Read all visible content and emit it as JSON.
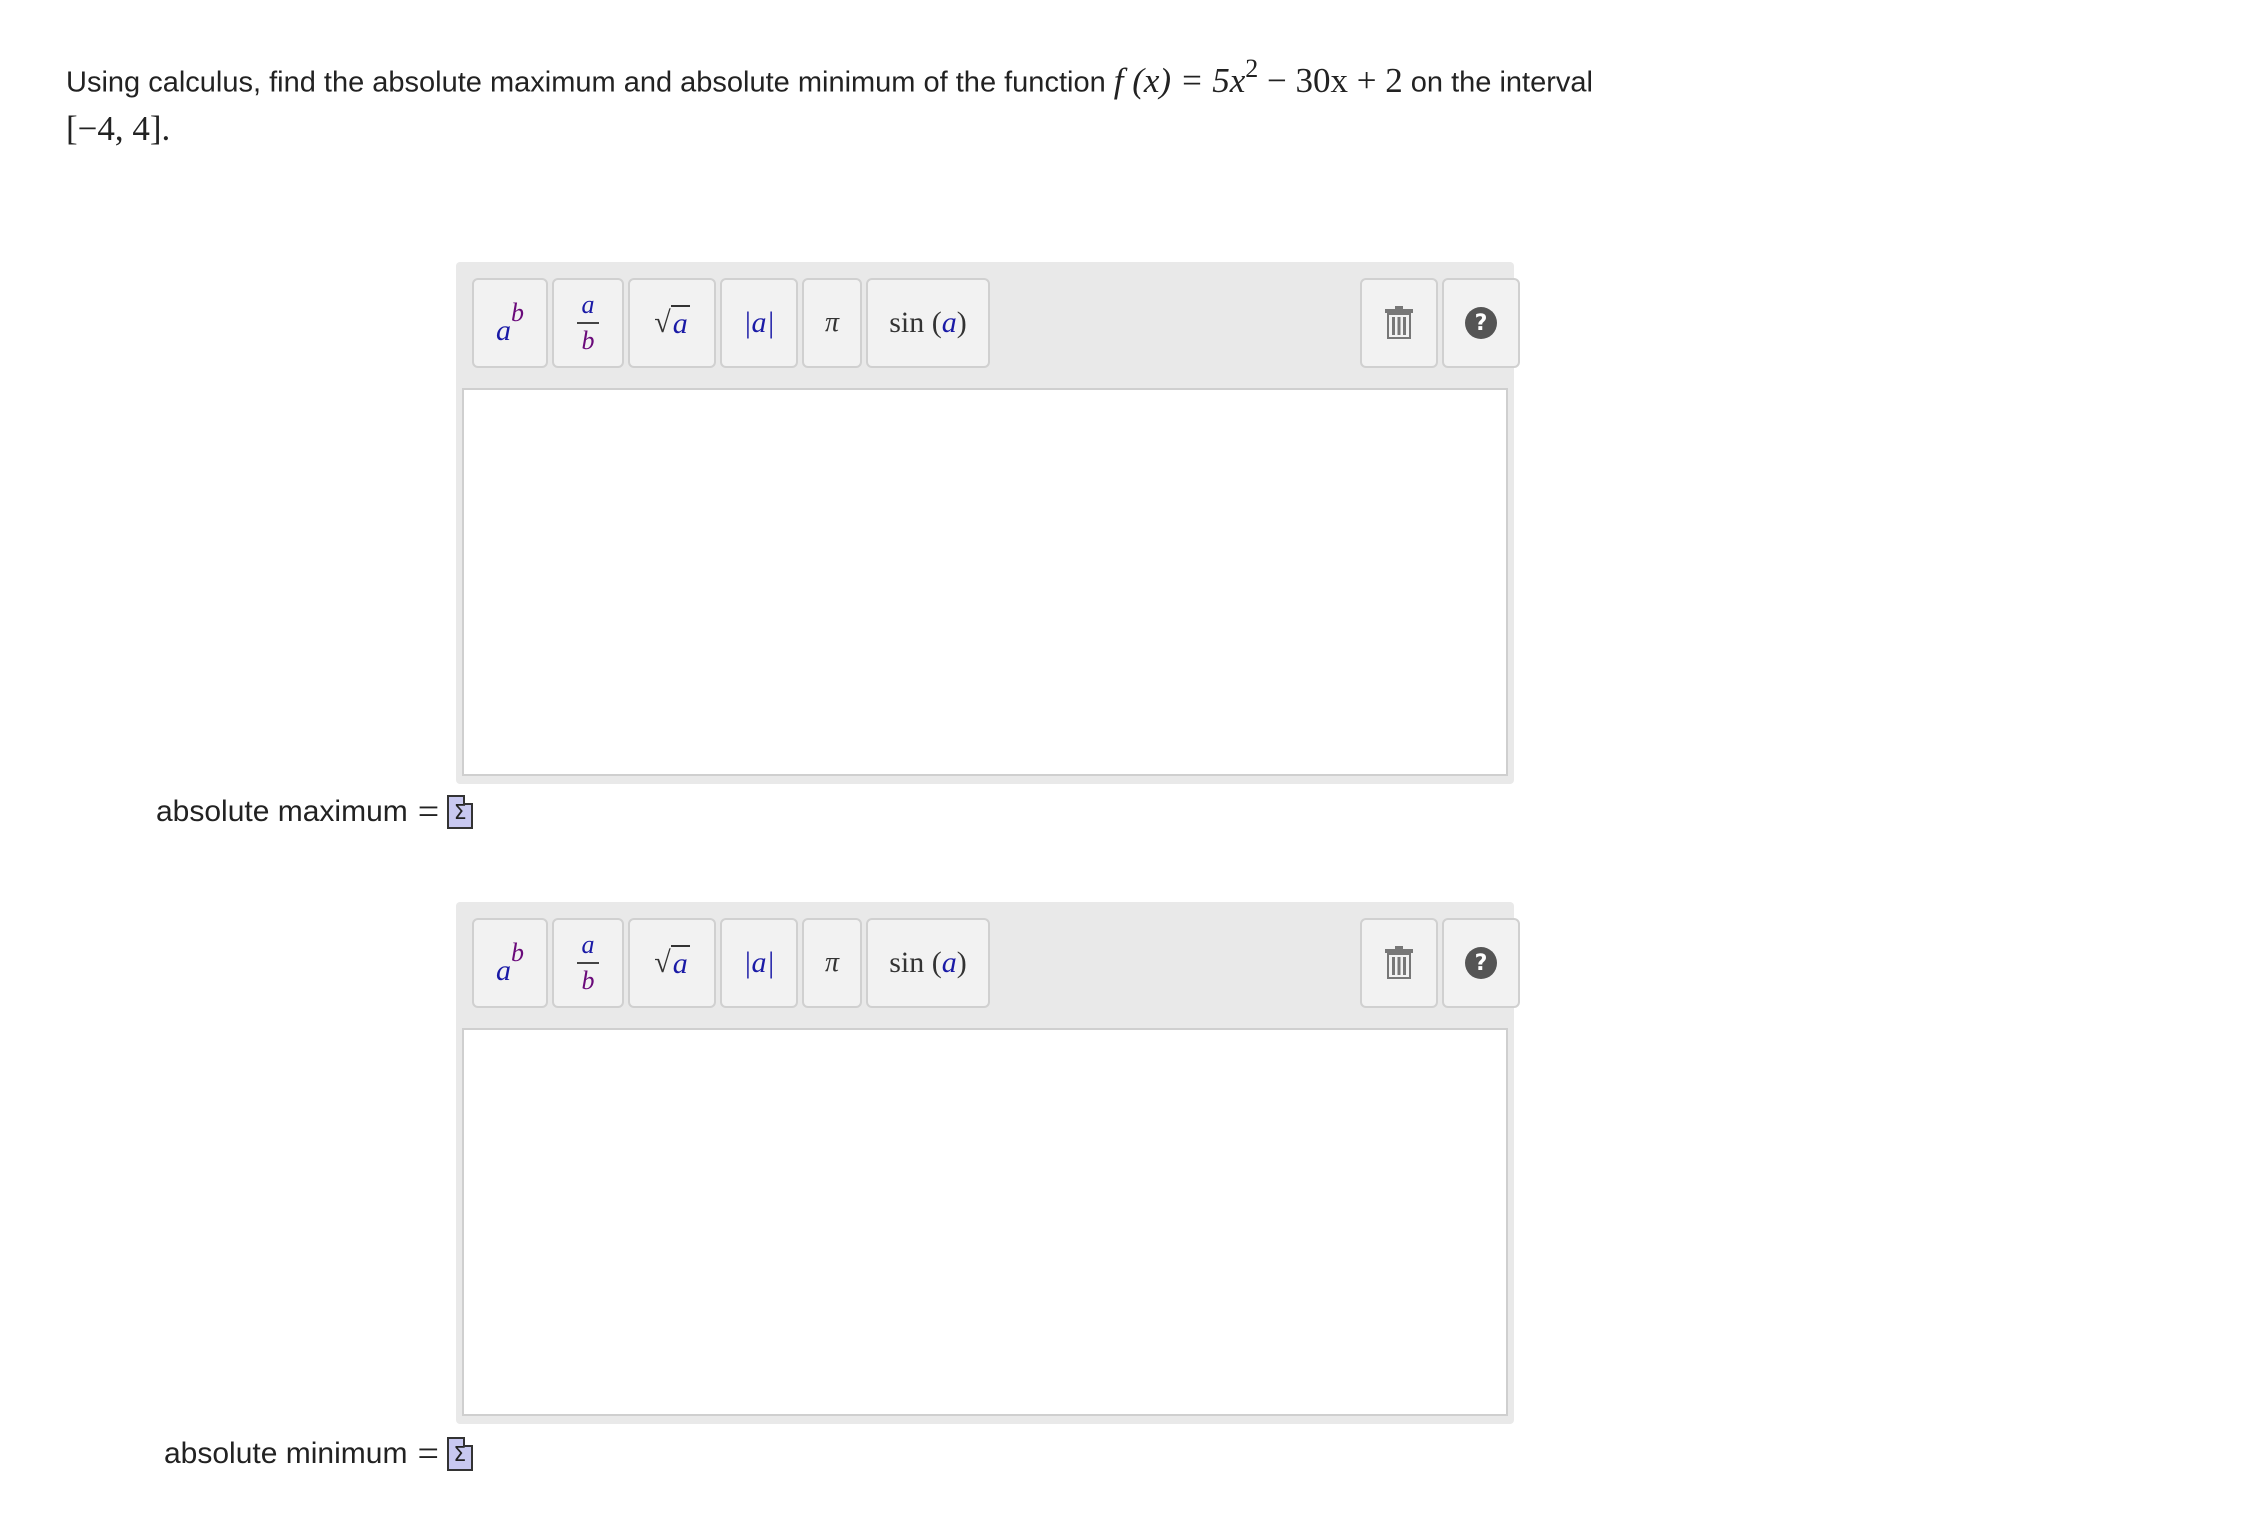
{
  "question": {
    "intro": "Using calculus, find the absolute maximum and absolute minimum of the function",
    "function_lhs": "f (x) = 5x",
    "exponent": "2",
    "function_rest": " − 30x + 2",
    "interval_text": "on the interval",
    "interval": "[−4, 4]."
  },
  "toolbar": {
    "power_base": "a",
    "power_exp": "b",
    "frac_num": "a",
    "frac_den": "b",
    "sqrt_radical": "√",
    "sqrt_arg": "a",
    "abs_label": "|a|",
    "pi_label": "π",
    "sin_label": "sin",
    "sin_arg": "a",
    "help_label": "?"
  },
  "answers": [
    {
      "label": "absolute maximum",
      "eq": "=",
      "value": ""
    },
    {
      "label": "absolute minimum",
      "eq": "=",
      "value": ""
    }
  ],
  "sigma_glyph": "Σ"
}
